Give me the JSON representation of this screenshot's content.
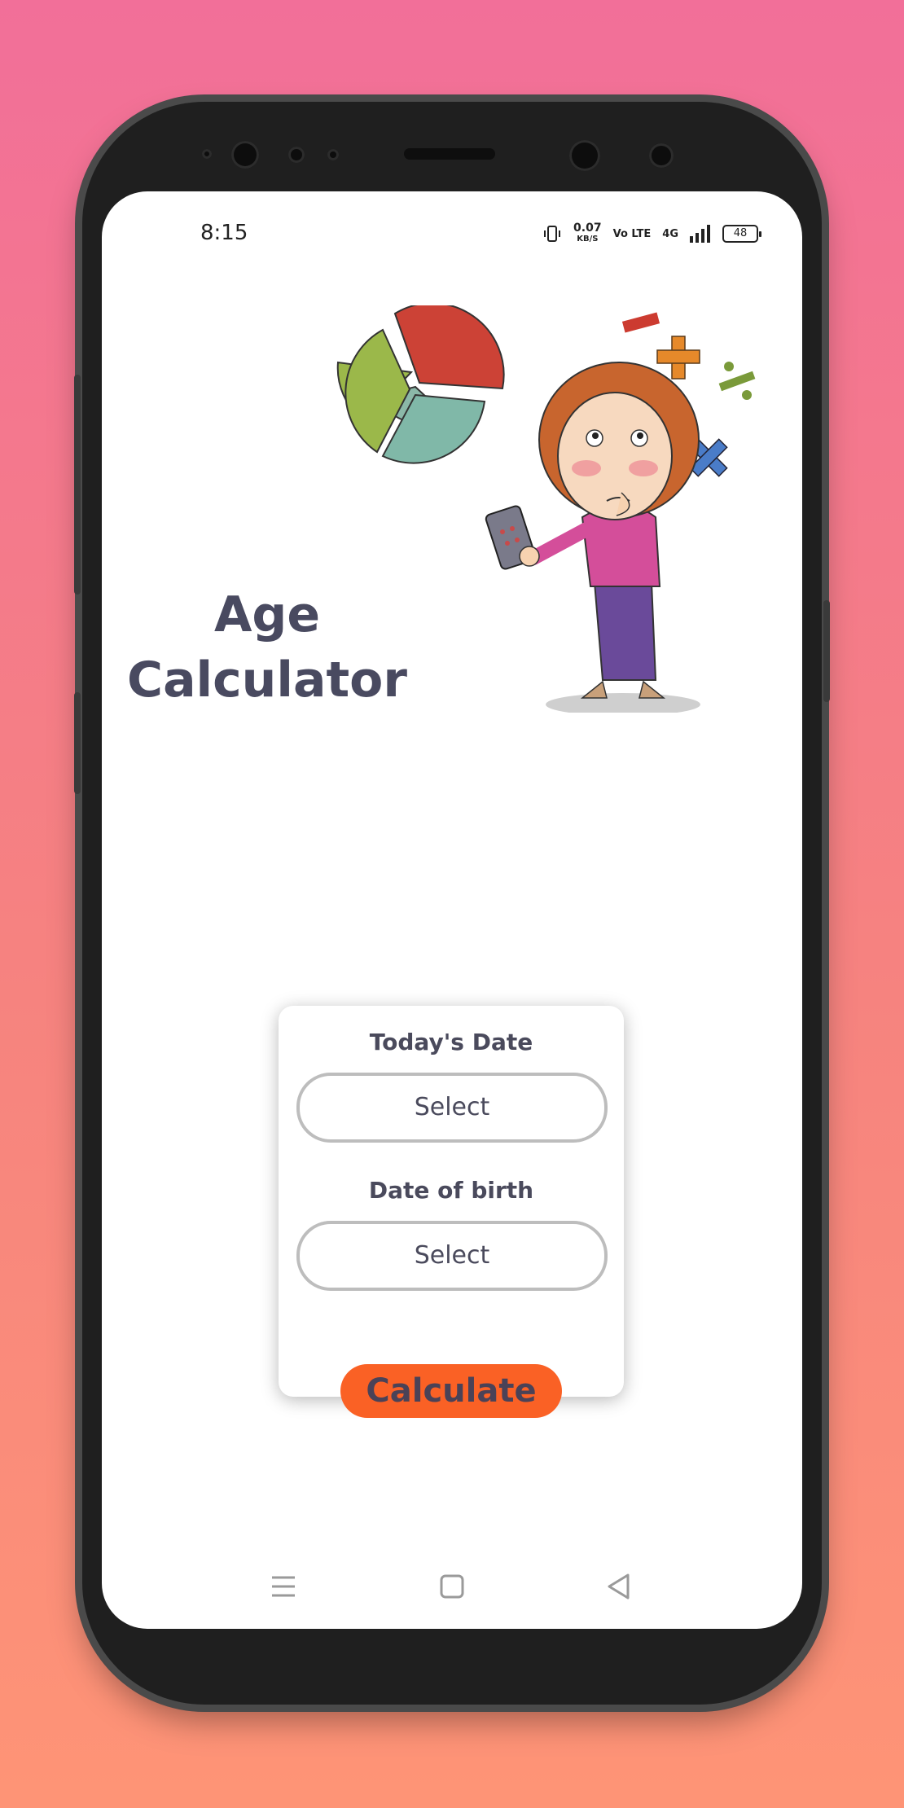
{
  "status_bar": {
    "time": "8:15",
    "speed_value": "0.07",
    "speed_unit": "KB/S",
    "volte": "Vo LTE",
    "network": "4G",
    "battery": "48"
  },
  "app": {
    "title_line1": "Age",
    "title_line2": "Calculator"
  },
  "form": {
    "todays_date_label": "Today's Date",
    "todays_date_value": "Select",
    "dob_label": "Date of birth",
    "dob_value": "Select",
    "calculate_label": "Calculate"
  },
  "nav": {
    "menu_icon": "menu-icon",
    "home_icon": "home-icon",
    "back_icon": "back-icon"
  },
  "colors": {
    "accent": "#fa6125",
    "text_dark": "#494a60",
    "background_top": "#f26f99",
    "background_bottom": "#fe9476"
  }
}
